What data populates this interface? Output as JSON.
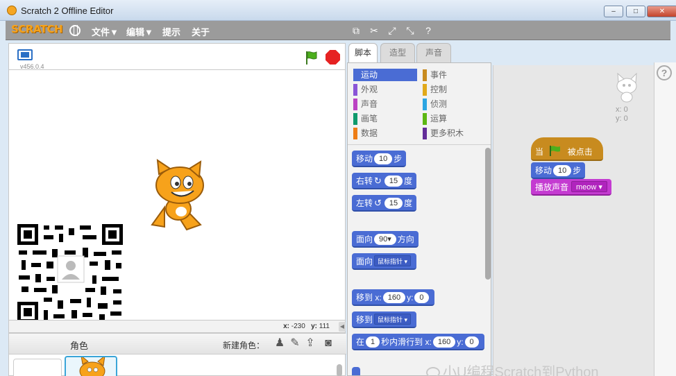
{
  "window": {
    "title": "Scratch 2 Offline Editor",
    "minimize": "–",
    "maximize": "□",
    "close": "✕"
  },
  "menubar": {
    "logo": "SCRATCH",
    "items": [
      "文件▼",
      "编辑▼",
      "提示",
      "关于"
    ],
    "tools": [
      "duplicate-icon",
      "delete-icon",
      "grow-icon",
      "shrink-icon",
      "help-icon"
    ]
  },
  "stage": {
    "version": "v456.0.4",
    "mouse_x_label": "x:",
    "mouse_x": "-230",
    "mouse_y_label": "y:",
    "mouse_y": "111"
  },
  "sprites": {
    "title": "角色",
    "new_sprite_label": "新建角色："
  },
  "tabs": [
    "脚本",
    "造型",
    "声音"
  ],
  "palette": {
    "categories": [
      {
        "label": "运动",
        "color": "#4a6cd4",
        "active": true
      },
      {
        "label": "事件",
        "color": "#c88b1f",
        "active": false
      },
      {
        "label": "外观",
        "color": "#8a55d7",
        "active": false
      },
      {
        "label": "控制",
        "color": "#e1a91a",
        "active": false
      },
      {
        "label": "声音",
        "color": "#bb42c3",
        "active": false
      },
      {
        "label": "侦测",
        "color": "#2ca5e2",
        "active": false
      },
      {
        "label": "画笔",
        "color": "#0e9a6c",
        "active": false
      },
      {
        "label": "运算",
        "color": "#5cb712",
        "active": false
      },
      {
        "label": "数据",
        "color": "#ee7d16",
        "active": false
      },
      {
        "label": "更多积木",
        "color": "#632d99",
        "active": false
      }
    ],
    "blocks": {
      "move": {
        "text": "移动",
        "value": "10",
        "suffix": "步"
      },
      "turn_right": {
        "text": "右转",
        "value": "15",
        "suffix": "度"
      },
      "turn_left": {
        "text": "左转",
        "value": "15",
        "suffix": "度"
      },
      "point_dir": {
        "text": "面向",
        "value": "90▾",
        "suffix": "方向"
      },
      "point_towards": {
        "text": "面向",
        "option": "鼠标指针 ▾"
      },
      "goto_xy": {
        "text": "移到",
        "x_label": "x:",
        "x": "160",
        "y_label": "y:",
        "y": "0"
      },
      "goto": {
        "text": "移到",
        "option": "鼠标指针 ▾"
      },
      "glide": {
        "text": "在",
        "secs": "1",
        "middle": "秒内滑行到",
        "x_label": "x:",
        "x": "160",
        "y_label": "y:",
        "y": "0"
      }
    }
  },
  "scripts": {
    "sprite_x": "x: 0",
    "sprite_y": "y: 0",
    "hat_prefix": "当",
    "hat_suffix": "被点击",
    "move_text": "移动",
    "move_value": "10",
    "move_suffix": "步",
    "sound_text": "播放声音",
    "sound_value": "meow ▾"
  },
  "watermark": "小U编程Scratch到Python",
  "help": "?"
}
